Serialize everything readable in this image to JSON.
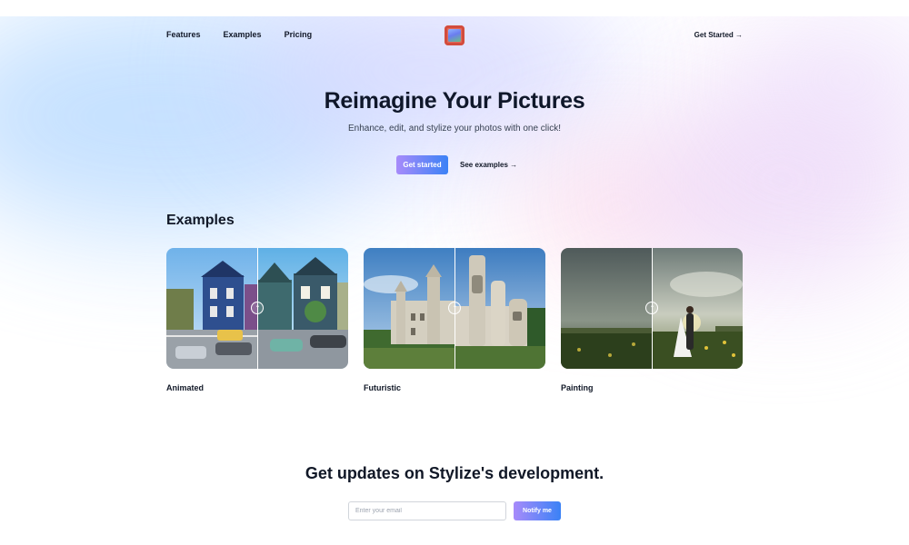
{
  "nav": {
    "links": [
      "Features",
      "Examples",
      "Pricing"
    ],
    "cta": "Get Started →"
  },
  "hero": {
    "title": "Reimagine Your Pictures",
    "subtitle": "Enhance, edit, and stylize your photos with one click!",
    "primary_button": "Get started",
    "secondary_link": "See examples →"
  },
  "examples": {
    "title": "Examples",
    "cards": [
      {
        "label": "Animated"
      },
      {
        "label": "Futuristic"
      },
      {
        "label": "Painting"
      }
    ]
  },
  "updates": {
    "title": "Get updates on Stylize's development.",
    "email_placeholder": "Enter your email",
    "button": "Notify me"
  },
  "colors": {
    "accent_start": "#a78bfa",
    "accent_end": "#3b82f6",
    "text": "#111827"
  },
  "icons": {
    "logo": "framed-picture-logo",
    "compare_handle": "compare-arrows-icon"
  }
}
